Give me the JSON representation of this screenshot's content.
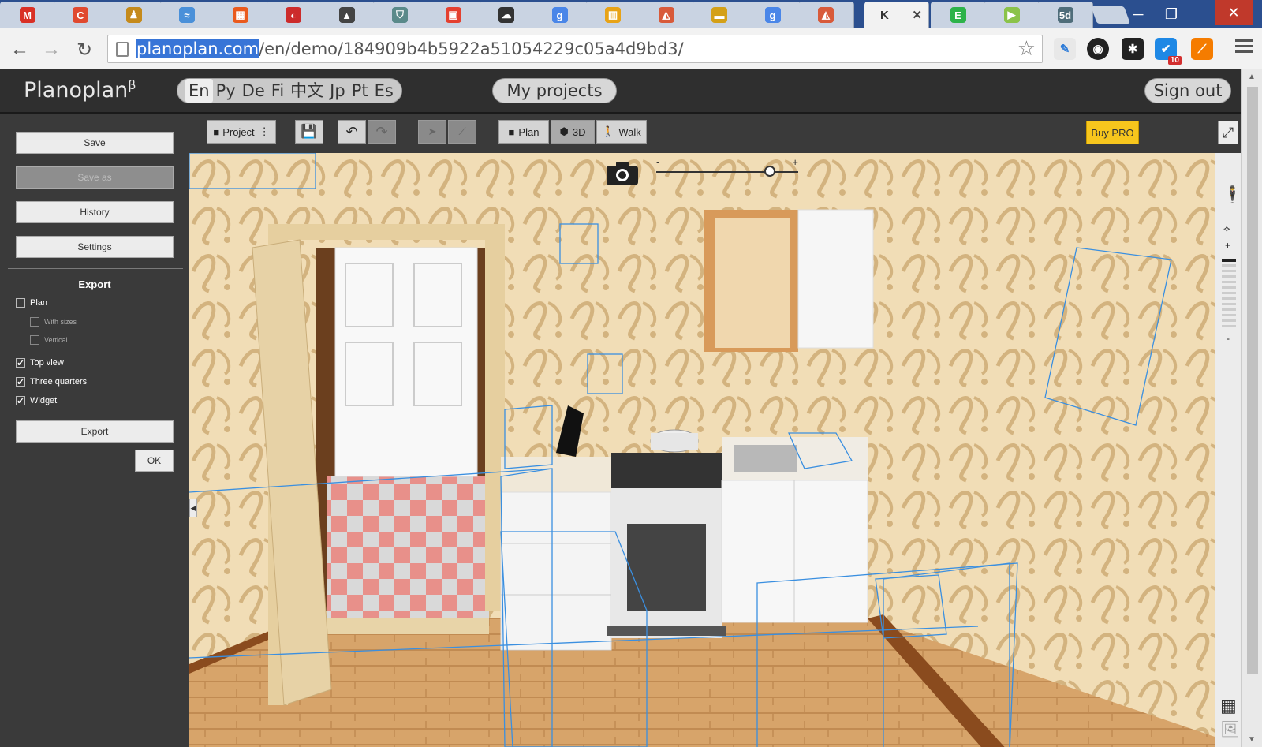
{
  "browser": {
    "tabs": [
      {
        "icon": "gmail-icon",
        "glyph": "M",
        "color": "#d93025"
      },
      {
        "icon": "creative-commons-icon",
        "glyph": "C",
        "color": "#e0492f"
      },
      {
        "icon": "person-icon",
        "glyph": "♟",
        "color": "#c58a1b"
      },
      {
        "icon": "wave-app-icon",
        "glyph": "≈",
        "color": "#4a90d9"
      },
      {
        "icon": "windows-store-icon",
        "glyph": "▦",
        "color": "#ea5a1d"
      },
      {
        "icon": "half-circle-icon",
        "glyph": "◐",
        "color": "#cc2b2b"
      },
      {
        "icon": "chart-icon",
        "glyph": "▲",
        "color": "#444"
      },
      {
        "icon": "shield-icon",
        "glyph": "⛉",
        "color": "#5a8a8a"
      },
      {
        "icon": "reader-icon",
        "glyph": "▣",
        "color": "#e4402f"
      },
      {
        "icon": "chat-icon",
        "glyph": "☁",
        "color": "#333"
      },
      {
        "icon": "google-icon",
        "glyph": "g",
        "color": "#4a86e8"
      },
      {
        "icon": "library-icon",
        "glyph": "▥",
        "color": "#e8a317"
      },
      {
        "icon": "triangle-app-icon",
        "glyph": "◭",
        "color": "#d85a3a"
      },
      {
        "icon": "ruler-icon",
        "glyph": "▬",
        "color": "#d4a017"
      },
      {
        "icon": "google-icon",
        "glyph": "g",
        "color": "#4a86e8"
      },
      {
        "icon": "triangle-app-icon",
        "glyph": "◭",
        "color": "#d85a3a"
      }
    ],
    "active_tab_label": "K",
    "more_tabs": [
      {
        "icon": "evernote-icon",
        "glyph": "E",
        "color": "#2db34a"
      },
      {
        "icon": "play-icon",
        "glyph": "▶",
        "color": "#8bc34a"
      },
      {
        "icon": "5d-icon",
        "glyph": "5d",
        "color": "#4f6d7a"
      }
    ],
    "url_selected": "planoplan.com",
    "url_rest": "/en/demo/184909b4b5922a51054229c05a4d9bd3/",
    "extension_badge": "10"
  },
  "header": {
    "logo": "Planoplan",
    "logo_sup": "β",
    "languages": [
      "En",
      "Ру",
      "De",
      "Fi",
      "中文",
      "Jp",
      "Pt",
      "Es"
    ],
    "active_language": "En",
    "my_projects": "My projects",
    "sign_out": "Sign out"
  },
  "side": {
    "save": "Save",
    "save_as": "Save as",
    "history": "History",
    "settings": "Settings",
    "export_title": "Export",
    "options": {
      "plan": "Plan",
      "with_sizes": "With sizes",
      "vertical": "Vertical",
      "top_view": "Top view",
      "three_quarters": "Three quarters",
      "widget": "Widget"
    },
    "checked": {
      "plan": false,
      "with_sizes": false,
      "vertical": false,
      "top_view": true,
      "three_quarters": true,
      "widget": true
    },
    "export_button": "Export",
    "ok": "OK"
  },
  "editor": {
    "project": "Project",
    "plan": "Plan",
    "threed": "3D",
    "walk": "Walk",
    "buy_pro": "Buy PRO",
    "zoom_minus": "-",
    "zoom_plus": "+",
    "zoom_level": 0.8,
    "rail_plus": "+",
    "rail_minus": "-"
  }
}
